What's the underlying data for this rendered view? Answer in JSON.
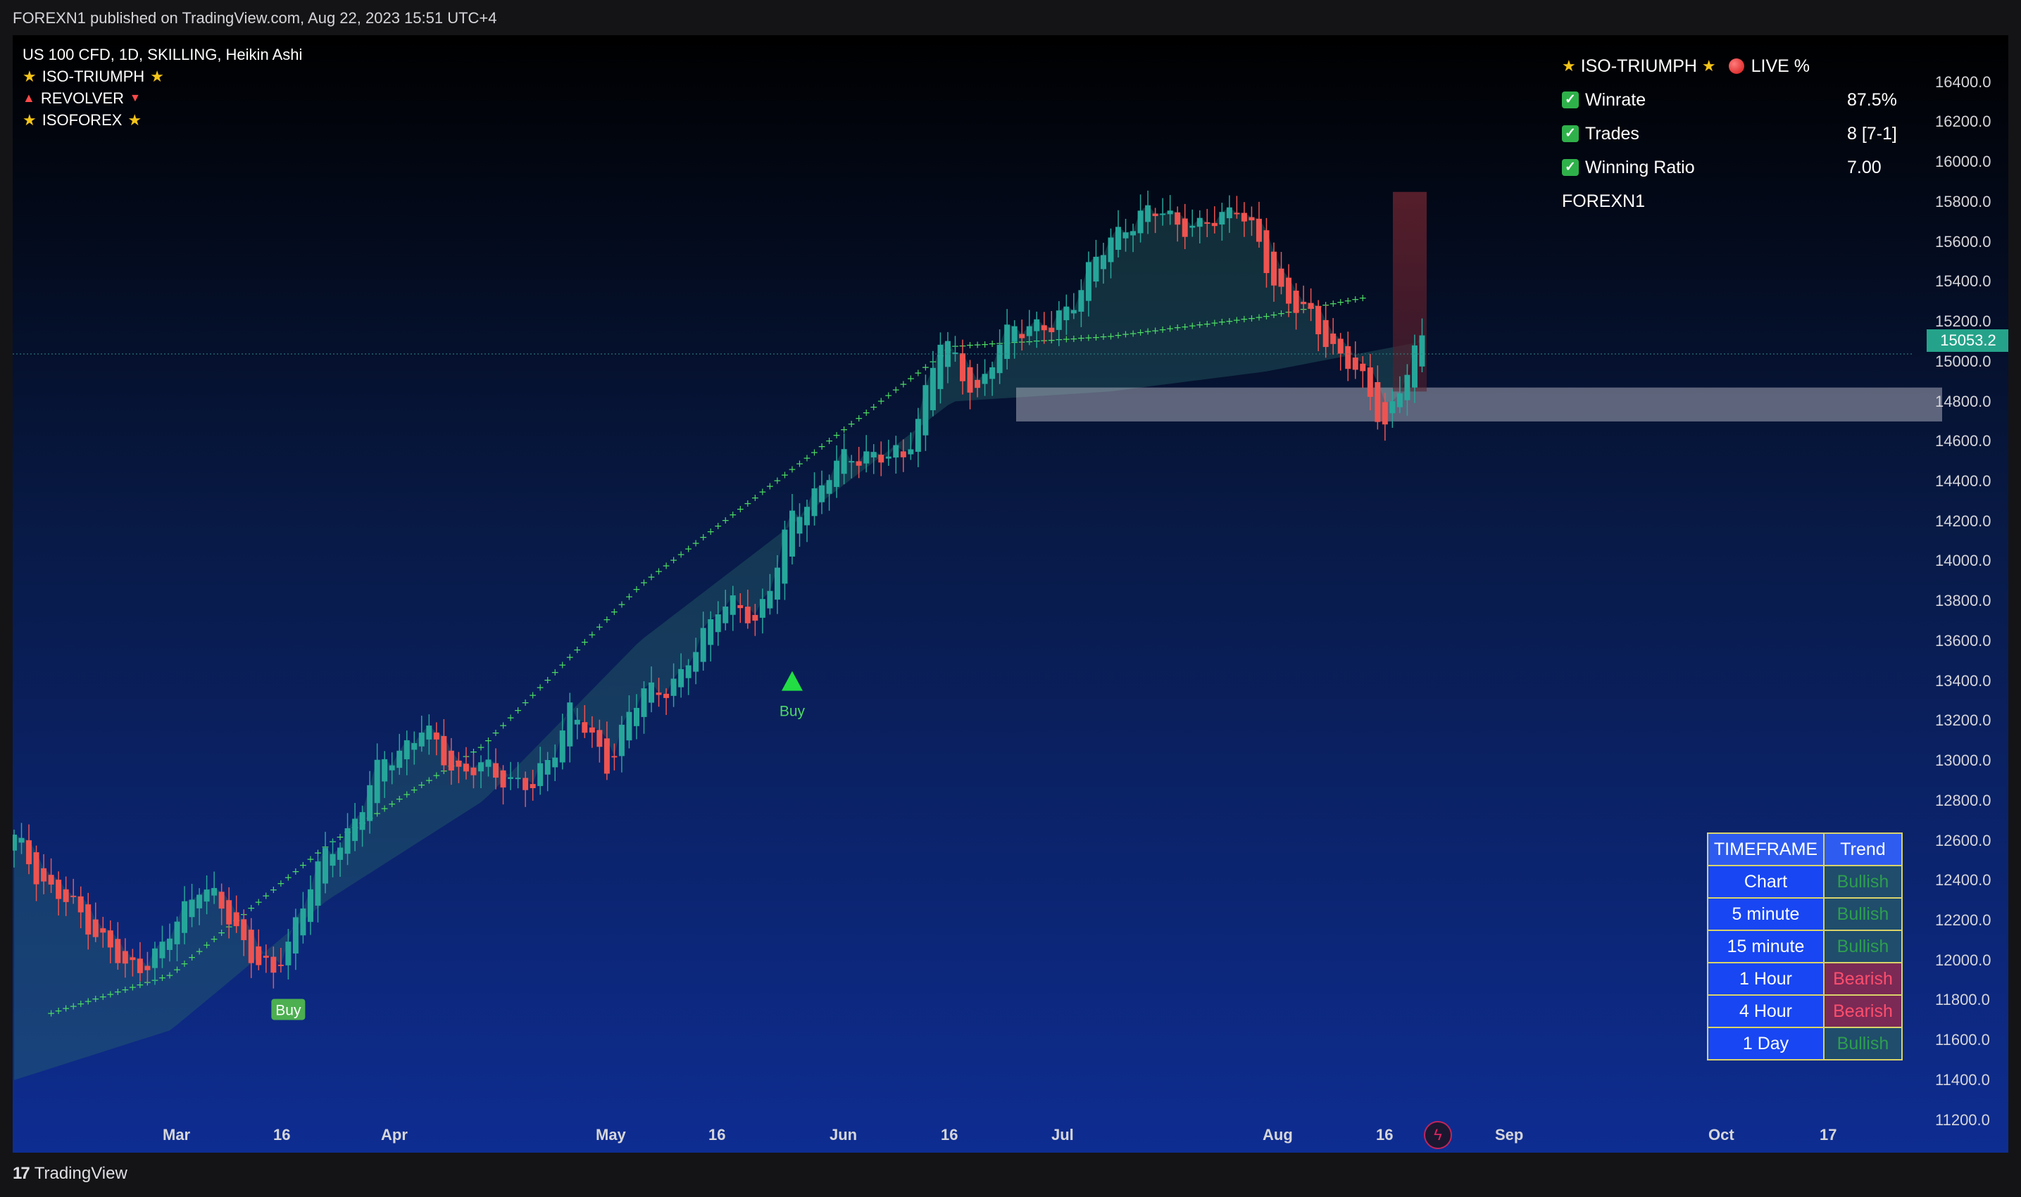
{
  "header": {
    "publisher_line": "FOREXN1 published on TradingView.com, Aug 22, 2023 15:51 UTC+4"
  },
  "legend": {
    "symbol_line": "US 100 CFD, 1D, SKILLING, Heikin Ashi",
    "indicators": [
      "ISO-TRIUMPH",
      "REVOLVER",
      "ISOFOREX"
    ]
  },
  "stats": {
    "title": "ISO-TRIUMPH",
    "live_label": "LIVE %",
    "rows": [
      {
        "label": "Winrate",
        "value": "87.5%"
      },
      {
        "label": "Trades",
        "value": "8 [7-1]"
      },
      {
        "label": "Winning Ratio",
        "value": "7.00"
      }
    ],
    "footer": "FOREXN1"
  },
  "trend_table": {
    "headers": [
      "TIMEFRAME",
      "Trend"
    ],
    "rows": [
      {
        "timeframe": "Chart",
        "trend": "Bullish"
      },
      {
        "timeframe": "5 minute",
        "trend": "Bullish"
      },
      {
        "timeframe": "15 minute",
        "trend": "Bullish"
      },
      {
        "timeframe": "1 Hour",
        "trend": "Bearish"
      },
      {
        "timeframe": "4 Hour",
        "trend": "Bearish"
      },
      {
        "timeframe": "1 Day",
        "trend": "Bullish"
      }
    ]
  },
  "footer": {
    "brand": "TradingView"
  },
  "colors": {
    "bull": "#26a69a",
    "bear": "#ef5350",
    "bullish_text": "#2e9e4f",
    "bearish_text": "#ff4d6d",
    "dots": "#4cd964",
    "price_tag": "#25a38a"
  },
  "chart_data": {
    "type": "candlestick",
    "style": "Heikin Ashi",
    "ylim": [
      11100,
      16600
    ],
    "yticks": [
      "16400.0",
      "16200.0",
      "16000.0",
      "15800.0",
      "15600.0",
      "15400.0",
      "15200.0",
      "15000.0",
      "14800.0",
      "14600.0",
      "14400.0",
      "14200.0",
      "14000.0",
      "13800.0",
      "13600.0",
      "13400.0",
      "13200.0",
      "13000.0",
      "12800.0",
      "12600.0",
      "12400.0",
      "12200.0",
      "12000.0",
      "11800.0",
      "11600.0",
      "11400.0",
      "11200.0"
    ],
    "xticks": [
      "Mar",
      "16",
      "Apr",
      "May",
      "16",
      "Jun",
      "16",
      "Jul",
      "Aug",
      "16",
      "Sep",
      "Oct",
      "17"
    ],
    "last_price": "15053.2",
    "signals": [
      {
        "label": "Buy",
        "price": 11800
      },
      {
        "label": "Buy",
        "price": 13400
      }
    ],
    "anchors": [
      [
        12550,
        12600
      ],
      [
        12400,
        12350
      ],
      [
        12250,
        12200
      ],
      [
        12050,
        11950
      ],
      [
        12100,
        12050
      ],
      [
        12300,
        12400
      ],
      [
        12250,
        12150
      ],
      [
        11950,
        11900
      ],
      [
        12350,
        12400
      ],
      [
        12600,
        12650
      ],
      [
        12900,
        13000
      ],
      [
        13100,
        13150
      ],
      [
        12900,
        12950
      ],
      [
        13000,
        12950
      ],
      [
        12950,
        12850
      ],
      [
        13100,
        13250
      ],
      [
        13050,
        13000
      ],
      [
        13250,
        13350
      ],
      [
        13350,
        13400
      ],
      [
        13650,
        13800
      ],
      [
        13750,
        13700
      ],
      [
        14050,
        14200
      ],
      [
        14400,
        14450
      ],
      [
        14500,
        14550
      ],
      [
        14450,
        14500
      ],
      [
        14950,
        15100
      ],
      [
        14950,
        14850
      ],
      [
        15100,
        15200
      ],
      [
        15050,
        15150
      ],
      [
        15300,
        15450
      ],
      [
        15600,
        15700
      ],
      [
        15800,
        15750
      ],
      [
        15550,
        15650
      ],
      [
        15700,
        15800
      ],
      [
        15550,
        15400
      ],
      [
        15300,
        15200
      ],
      [
        15100,
        15000
      ],
      [
        14800,
        14700
      ],
      [
        14900,
        15100
      ]
    ],
    "cloud": [
      [
        11400,
        11550
      ],
      [
        11650,
        11650
      ],
      [
        12300,
        12350
      ],
      [
        12800,
        12950
      ],
      [
        13600,
        13550
      ],
      [
        14200,
        14400
      ],
      [
        14800,
        14850
      ],
      [
        14850,
        14950
      ],
      [
        14950,
        15000
      ],
      [
        15100,
        15100
      ]
    ],
    "support_zone": [
      14700,
      14870
    ]
  }
}
